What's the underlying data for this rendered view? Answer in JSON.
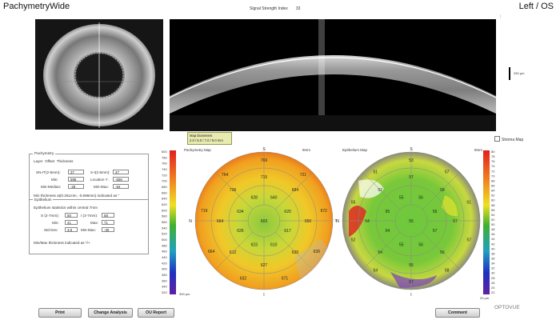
{
  "app": {
    "title": "PachymetryWide",
    "eye": "Left / OS"
  },
  "signal": {
    "label": "Signal Strength Index",
    "value": "33"
  },
  "bscan": {
    "scale_label": "250 µm"
  },
  "map_diameters": {
    "title": "Map Diameters",
    "values": "2.0 / 5.0 / 7.0 / 9.0 mm"
  },
  "stroma_map": {
    "label": "Stroma Map",
    "checked": false
  },
  "pachymetry_panel": {
    "legend": "Pachymetry",
    "tabs": [
      "Layer",
      "Offset",
      "Thickness"
    ],
    "sn_it_label": "SN-IT(2-5mm):",
    "sn_it_value": "37",
    "s_i_label": "S-I(2-5mm):",
    "s_i_value": "47",
    "min_label": "Min:",
    "min_value": "595",
    "location_label": "Location Y:",
    "location_value": "-506",
    "min_median_label": "Min-Median:",
    "min_median_value": "-28",
    "min_max_label": "Min-Max:",
    "min_max_value": "-94",
    "min_thickness_note": "Min thickness at(0.261mm, -0.696mm) indicated as \"",
    "epithelium_legend": "Epithelium",
    "epi_stats_title": "Epithelium statistics within central 7mm",
    "s_label": "S (2-7mm):",
    "s_value": "50",
    "i_label": "I (2-7mm):",
    "i_value": "58",
    "epi_min_label": "Min:",
    "epi_min_value": "41",
    "epi_max_label": "Max:",
    "epi_max_value": "71",
    "std_label": "Std Dev:",
    "std_value": "3.8",
    "epi_minmax_label": "Min-Max:",
    "epi_minmax_value": "-30",
    "note": "Min/Max thickness indicated as */+"
  },
  "pachy_map": {
    "title": "Pachymetry Map",
    "unit": "9mm",
    "north": "N",
    "south": "I",
    "top": "S",
    "temporal": "T",
    "colors": {
      "accent": "#e8a020"
    },
    "scale_top": "800",
    "scale_labels": [
      "800",
      "780",
      "760",
      "740",
      "720",
      "700",
      "680",
      "660",
      "640",
      "620",
      "600",
      "580",
      "560",
      "540",
      "520",
      "500",
      "480",
      "460",
      "440",
      "420",
      "400",
      "380",
      "360",
      "340",
      "320"
    ],
    "scale_unit": "300 µm",
    "center": "603",
    "ring1": [
      "640",
      "620",
      "617",
      "610",
      "623",
      "626",
      "634",
      "628"
    ],
    "ring2": [
      "715",
      "684",
      "650",
      "639",
      "627",
      "612",
      "664",
      "706"
    ],
    "ring3": [
      "769",
      "721",
      "672",
      "639",
      "671",
      "632",
      "664",
      "719",
      "764"
    ],
    "extra": [
      "655",
      "681",
      "579"
    ],
    "corner_small": [
      "88",
      "87",
      "82",
      "81"
    ]
  },
  "epi_map": {
    "title": "Epithelium Map",
    "unit": "9mm",
    "west": "N",
    "top": "S",
    "east": "T",
    "bottom": "I",
    "scale_labels": [
      "80",
      "78",
      "76",
      "74",
      "72",
      "70",
      "68",
      "66",
      "64",
      "62",
      "60",
      "58",
      "56",
      "54",
      "52",
      "50",
      "48",
      "46",
      "44",
      "42",
      "40",
      "38",
      "36",
      "34",
      "32",
      "30",
      "28",
      "26",
      "24",
      "22"
    ],
    "scale_unit": "20 µm",
    "center": "55",
    "ring1": [
      "56",
      "56",
      "57",
      "56",
      "55",
      "54",
      "55",
      "55"
    ],
    "ring2": [
      "57",
      "58",
      "57",
      "56",
      "55",
      "54",
      "54",
      "52"
    ],
    "ring3": [
      "53",
      "57",
      "51",
      "57",
      "58",
      "57",
      "54",
      "52",
      "55",
      "51"
    ],
    "extra": [
      "62",
      "55"
    ]
  },
  "buttons": {
    "print": "Print",
    "change_analysis": "Change Analysis",
    "ou_report": "OU Report",
    "comment": "Comment"
  },
  "logo": "OPTOVUE"
}
